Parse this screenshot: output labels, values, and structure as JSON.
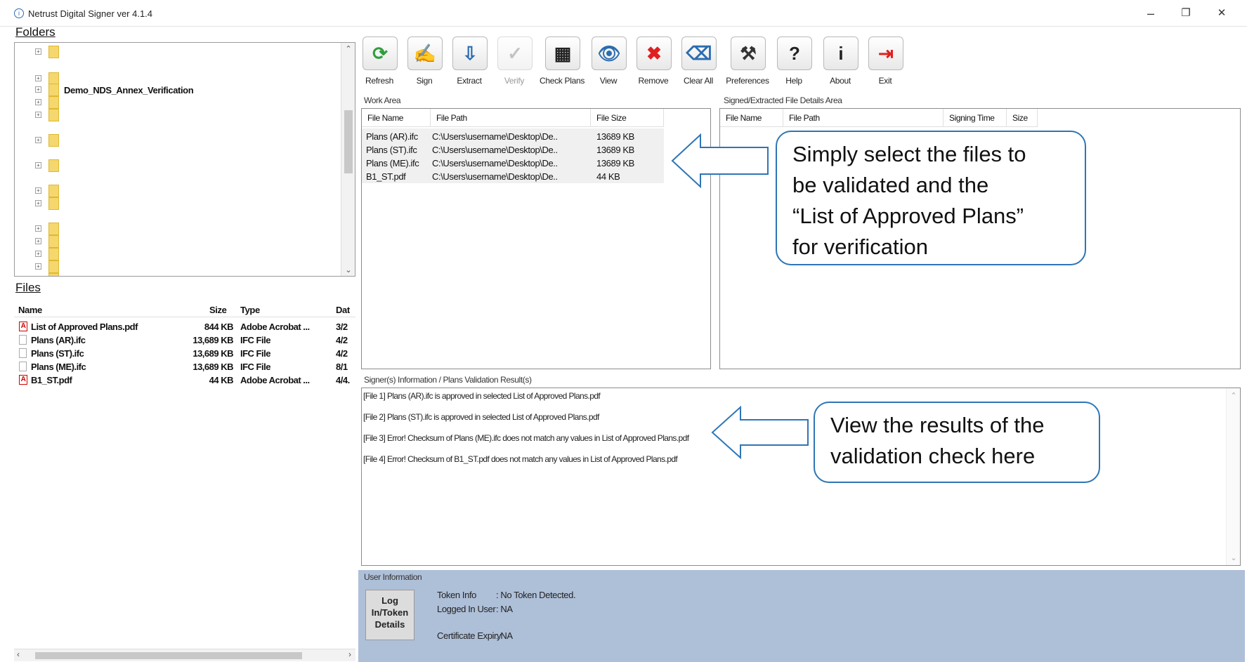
{
  "window": {
    "title": "Netrust Digital Signer ver 4.1.4",
    "app_icon": "info-circle-icon",
    "minimize": "–",
    "maximize": "❐",
    "close": "✕"
  },
  "folders": {
    "label": "Folders",
    "items": [
      {
        "label": ""
      },
      {
        "label": ""
      },
      {
        "label": "Demo_NDS_Annex_Verification"
      },
      {
        "label": ""
      },
      {
        "label": ""
      },
      {
        "label": ""
      },
      {
        "label": ""
      },
      {
        "label": ""
      },
      {
        "label": ""
      },
      {
        "label": ""
      },
      {
        "label": ""
      },
      {
        "label": ""
      },
      {
        "label": ""
      },
      {
        "label": ""
      }
    ]
  },
  "files": {
    "label": "Files",
    "columns": [
      "Name",
      "Size",
      "Type",
      "Dat"
    ],
    "rows": [
      {
        "name": "List of Approved Plans.pdf",
        "size": "844 KB",
        "type": "Adobe Acrobat ...",
        "date": "3/2",
        "icon": "pdf-icon"
      },
      {
        "name": "Plans (AR).ifc",
        "size": "13,689 KB",
        "type": "IFC File",
        "date": "4/2",
        "icon": "file-icon"
      },
      {
        "name": "Plans (ST).ifc",
        "size": "13,689 KB",
        "type": "IFC File",
        "date": "4/2",
        "icon": "file-icon"
      },
      {
        "name": "Plans (ME).ifc",
        "size": "13,689 KB",
        "type": "IFC File",
        "date": "8/1",
        "icon": "file-icon"
      },
      {
        "name": "B1_ST.pdf",
        "size": "44 KB",
        "type": "Adobe Acrobat ...",
        "date": "4/4.",
        "icon": "pdf-icon"
      }
    ]
  },
  "toolbar": {
    "buttons": [
      {
        "label": "Refresh",
        "icon": "refresh-icon",
        "glyph": "⟳",
        "color": "#2e9e3e",
        "enabled": true
      },
      {
        "label": "Sign",
        "icon": "sign-pen-icon",
        "glyph": "✍",
        "color": "#444444",
        "enabled": true
      },
      {
        "label": "Extract",
        "icon": "extract-icon",
        "glyph": "⇩",
        "color": "#2b6cb0",
        "enabled": true
      },
      {
        "label": "Verify",
        "icon": "verify-icon",
        "glyph": "✓",
        "color": "#888888",
        "enabled": false
      },
      {
        "label": "Check Plans",
        "icon": "qr-code-icon",
        "glyph": "▦",
        "color": "#222222",
        "enabled": true
      },
      {
        "label": "View",
        "icon": "eye-icon",
        "glyph": "👁",
        "color": "#2b6cb0",
        "enabled": true
      },
      {
        "label": "Remove",
        "icon": "remove-x-icon",
        "glyph": "✖",
        "color": "#e02020",
        "enabled": true
      },
      {
        "label": "Clear All",
        "icon": "eraser-icon",
        "glyph": "⌫",
        "color": "#2b6cb0",
        "enabled": true
      },
      {
        "label": "Preferences",
        "icon": "tools-icon",
        "glyph": "⚒",
        "color": "#333333",
        "enabled": true
      },
      {
        "label": "Help",
        "icon": "help-icon",
        "glyph": "?",
        "color": "#222222",
        "enabled": true
      },
      {
        "label": "About",
        "icon": "about-info-icon",
        "glyph": "i",
        "color": "#222222",
        "enabled": true
      },
      {
        "label": "Exit",
        "icon": "exit-icon",
        "glyph": "⇥",
        "color": "#e02020",
        "enabled": true
      }
    ]
  },
  "work_area": {
    "label": "Work Area",
    "columns": [
      "File Name",
      "File Path",
      "File Size"
    ],
    "rows": [
      {
        "name": "Plans (AR).ifc",
        "path": "C:\\Users\\username\\Desktop\\De..",
        "size": "13689 KB"
      },
      {
        "name": "Plans (ST).ifc",
        "path": "C:\\Users\\username\\Desktop\\De..",
        "size": "13689 KB"
      },
      {
        "name": "Plans (ME).ifc",
        "path": "C:\\Users\\username\\Desktop\\De..",
        "size": "13689 KB"
      },
      {
        "name": "B1_ST.pdf",
        "path": "C:\\Users\\username\\Desktop\\De..",
        "size": "44 KB"
      }
    ]
  },
  "signed_area": {
    "label": "Signed/Extracted File Details Area",
    "columns": [
      "File Name",
      "File Path",
      "Signing Time",
      "Size"
    ]
  },
  "results": {
    "label": "Signer(s) Information / Plans Validation Result(s)",
    "lines": [
      "[File 1] Plans (AR).ifc is approved in selected List of Approved Plans.pdf",
      "[File 2] Plans (ST).ifc is approved in selected List of Approved Plans.pdf",
      "[File 3] Error! Checksum of Plans (ME).ifc does not match any values in List of Approved Plans.pdf",
      "[File 4] Error! Checksum of B1_ST.pdf does not match any values in List of Approved Plans.pdf"
    ]
  },
  "user_info": {
    "label": "User Information",
    "login_button": [
      "Log",
      "In/Token",
      "Details"
    ],
    "token_label": "Token Info",
    "token_value": ": No Token Detected.",
    "user_label": "Logged In User",
    "user_value": ": NA",
    "expiry_label": "Certificate Expiry",
    "expiry_value": ": NA",
    "background": "#aebfd8"
  },
  "callouts": {
    "select_files": [
      "Simply select the files to",
      "be validated and the",
      "“List of Approved Plans”",
      "for verification"
    ],
    "view_results": [
      "View the results of the",
      "validation check here"
    ],
    "border_color": "#2e75b6"
  }
}
